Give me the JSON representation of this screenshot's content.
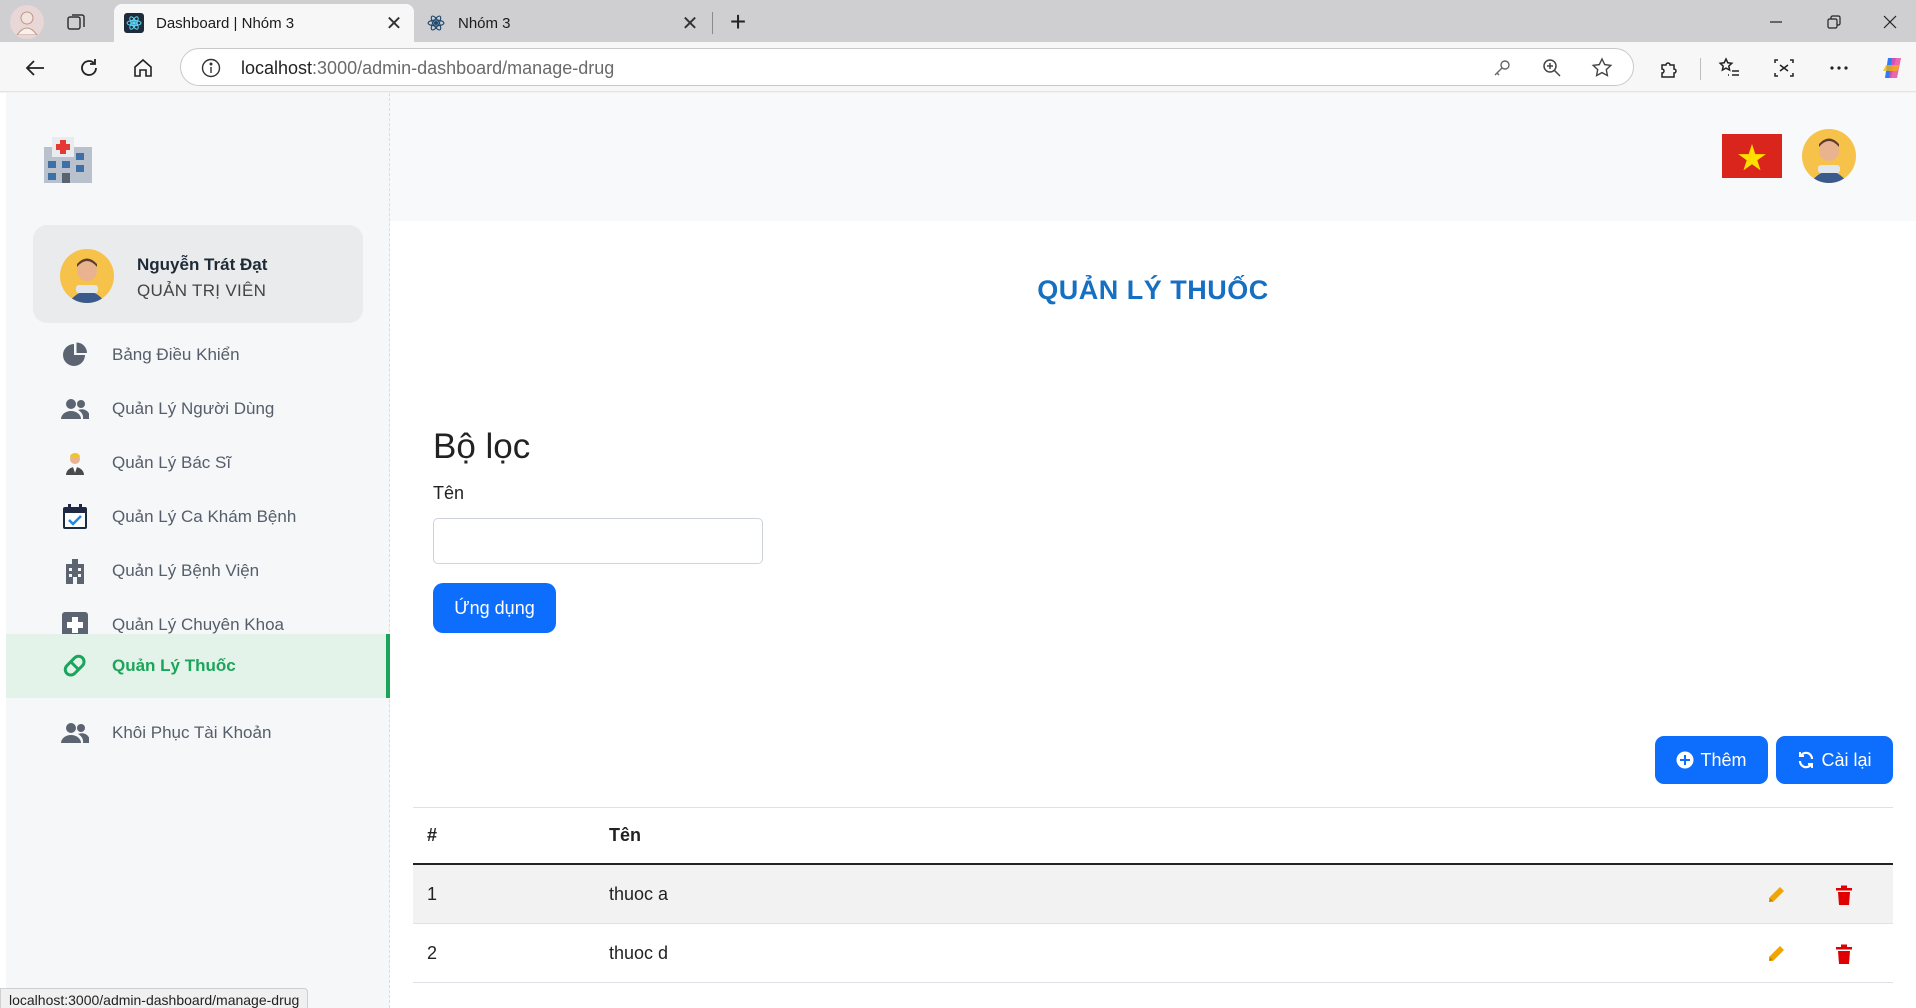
{
  "browser": {
    "tabs": [
      {
        "title": "Dashboard | Nhóm 3",
        "active": true
      },
      {
        "title": "Nhóm 3",
        "active": false
      }
    ],
    "url_host": "localhost",
    "url_rest": ":3000/admin-dashboard/manage-drug",
    "status_url": "localhost:3000/admin-dashboard/manage-drug"
  },
  "sidebar": {
    "user": {
      "name": "Nguyễn Trát Đạt",
      "role": "QUẢN TRỊ VIÊN"
    },
    "items": [
      {
        "label": "Bảng Điều Khiển",
        "icon": "pie-chart-icon"
      },
      {
        "label": "Quản Lý Người Dùng",
        "icon": "users-icon"
      },
      {
        "label": "Quản Lý Bác Sĩ",
        "icon": "doctor-icon"
      },
      {
        "label": "Quản Lý Ca Khám Bệnh",
        "icon": "calendar-check-icon"
      },
      {
        "label": "Quản Lý Bệnh Viện",
        "icon": "hospital-building-icon"
      },
      {
        "label": "Quản Lý Chuyên Khoa",
        "icon": "medical-cross-icon"
      },
      {
        "label": "Quản Lý Thuốc",
        "icon": "pills-icon",
        "active": true
      },
      {
        "label": "Khôi Phục Tài Khoản",
        "icon": "users-restore-icon"
      }
    ]
  },
  "main": {
    "title": "QUẢN LÝ THUỐC",
    "filter": {
      "heading": "Bộ lọc",
      "name_label": "Tên",
      "name_value": "",
      "apply_label": "Ứng dụng"
    },
    "actions": {
      "add_label": "Thêm",
      "reset_label": "Cài lại"
    },
    "table": {
      "columns": [
        "#",
        "Tên"
      ],
      "rows": [
        {
          "num": "1",
          "name": "thuoc a"
        },
        {
          "num": "2",
          "name": "thuoc d"
        }
      ]
    }
  },
  "colors": {
    "accent_green": "#1aa55a",
    "primary_blue": "#0d6efd",
    "title_blue": "#1670c2",
    "edit_orange": "#f0a500",
    "delete_red": "#e00000"
  }
}
